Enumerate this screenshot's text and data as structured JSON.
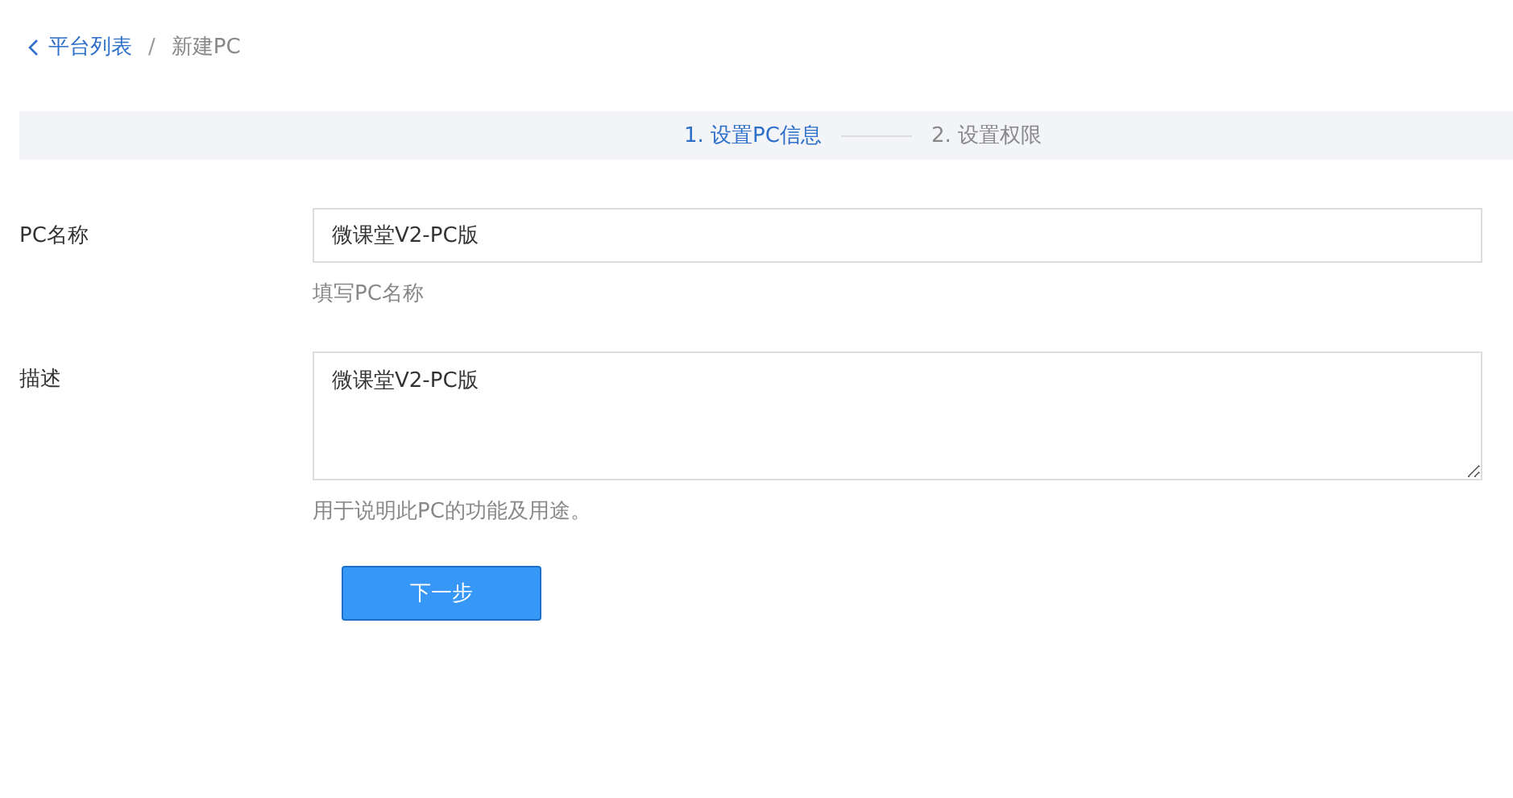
{
  "breadcrumb": {
    "back": {
      "label": "平台列表"
    },
    "separator": "/",
    "current": "新建PC"
  },
  "steps": [
    {
      "label": "1. 设置PC信息",
      "selected": true
    },
    {
      "label": "2. 设置权限",
      "selected": false
    }
  ],
  "form": {
    "fields": [
      {
        "kind": "input",
        "label": "PC名称",
        "value": "微课堂V2-PC版",
        "hint": "填写PC名称"
      },
      {
        "kind": "textarea",
        "label": "描述",
        "value": "微课堂V2-PC版",
        "hint": "用于说明此PC的功能及用途。"
      }
    ],
    "submit": "下一步"
  }
}
